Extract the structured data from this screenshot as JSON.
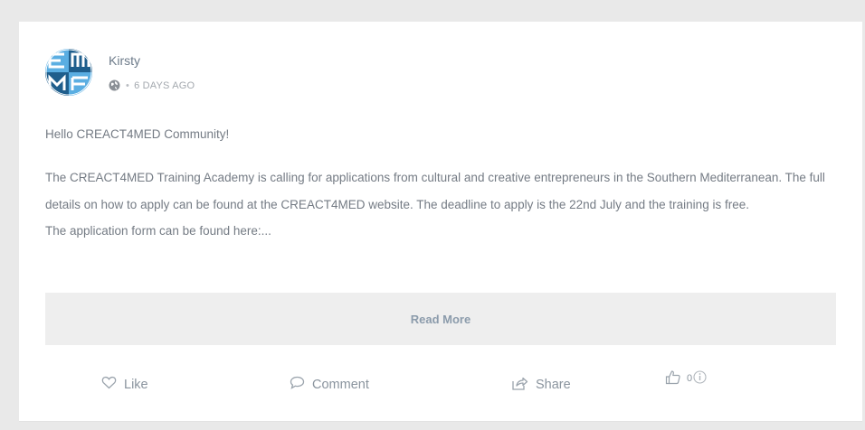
{
  "post": {
    "author": "Kirsty",
    "time": "6 DAYS AGO",
    "greeting": "Hello CREACT4MED Community!",
    "paragraphs": [
      "The CREACT4MED Training Academy is calling for applications from cultural and creative entrepreneurs in the Southern Mediterranean. The full details on how to apply can be found at the CREACT4MED website. The deadline to apply is the 22nd July and the training is free.",
      "The application form can be found here:..."
    ],
    "read_more_label": "Read More"
  },
  "actions": {
    "like_label": "Like",
    "comment_label": "Comment",
    "share_label": "Share",
    "reaction_count": "0"
  },
  "colors": {
    "avatar_blue": "#1f5e8c",
    "avatar_light": "#57aee0",
    "text": "#747b84",
    "read_more_bg": "#eeeeee"
  },
  "icons": [
    "globe-icon",
    "heart-icon",
    "comment-bubble-icon",
    "share-icon",
    "thumbs-up-icon",
    "info-icon"
  ]
}
